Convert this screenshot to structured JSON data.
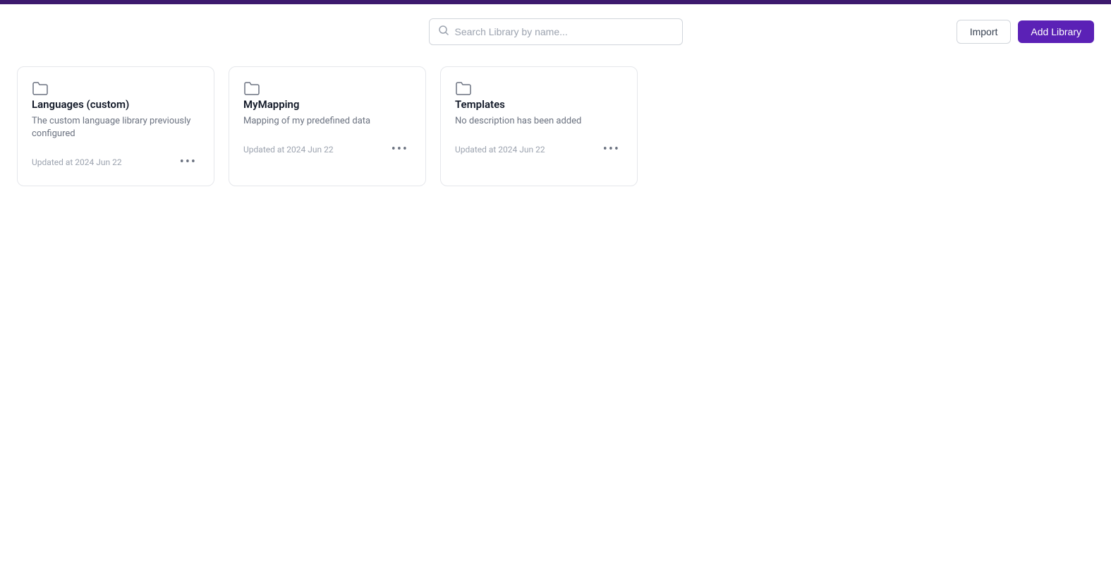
{
  "topbar": {
    "color": "#3d1a6e"
  },
  "search": {
    "placeholder": "Search Library by name..."
  },
  "header": {
    "import_label": "Import",
    "add_library_label": "Add Library"
  },
  "cards": [
    {
      "id": "languages-custom",
      "title": "Languages (custom)",
      "description": "The custom language library previously configured",
      "updated": "Updated at 2024 Jun 22",
      "icon": "folder"
    },
    {
      "id": "my-mapping",
      "title": "MyMapping",
      "description": "Mapping of my predefined data",
      "updated": "Updated at 2024 Jun 22",
      "icon": "folder"
    },
    {
      "id": "templates",
      "title": "Templates",
      "description": "No description has been added",
      "updated": "Updated at 2024 Jun 22",
      "icon": "folder"
    }
  ]
}
